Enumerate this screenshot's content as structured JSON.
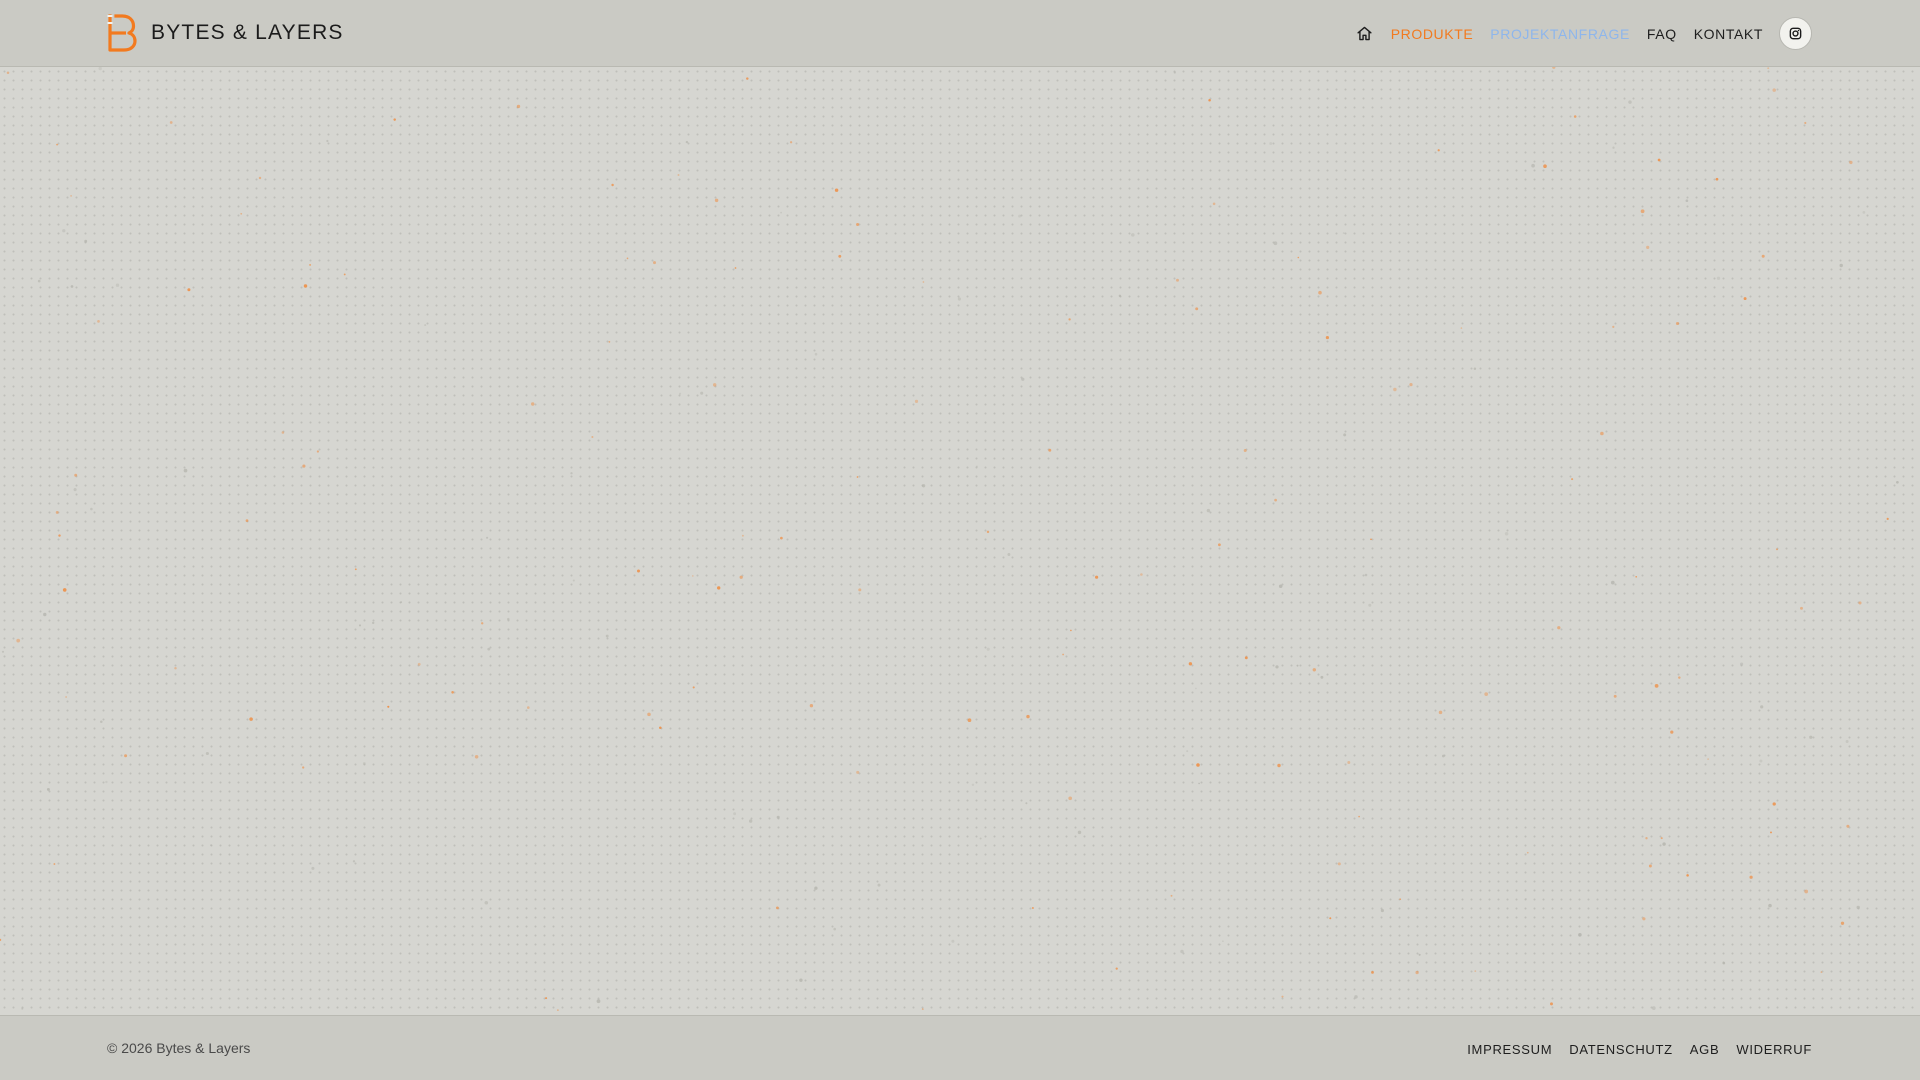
{
  "brand": {
    "name": "BYTES & LAYERS",
    "logo_icon": "bytes-and-layers-logo"
  },
  "nav": {
    "home_icon": "home-icon",
    "items": [
      {
        "label": "PRODUKTE",
        "state": "active"
      },
      {
        "label": "PROJEKTANFRAGE",
        "state": "hover"
      },
      {
        "label": "FAQ",
        "state": "default"
      },
      {
        "label": "KONTAKT",
        "state": "default"
      }
    ],
    "social_icon": "instagram-icon"
  },
  "footer": {
    "copyright": "© 2026 Bytes & Layers",
    "links": [
      {
        "label": "IMPRESSUM"
      },
      {
        "label": "DATENSCHUTZ"
      },
      {
        "label": "AGB"
      },
      {
        "label": "WIDERRUF"
      }
    ]
  },
  "colors": {
    "accent": "#f27a1f",
    "hover_link": "#8eb6ec",
    "background": "#d6d6d1",
    "header_footer": "#cacac4"
  }
}
